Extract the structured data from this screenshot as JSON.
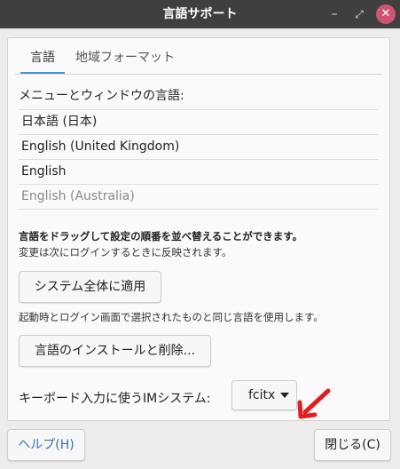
{
  "window": {
    "title": "言語サポート",
    "controls": {
      "minimize": "–",
      "maximize": "⤢",
      "close": "✕"
    }
  },
  "tabs": [
    {
      "label": "言語",
      "active": true
    },
    {
      "label": "地域フォーマット",
      "active": false
    }
  ],
  "language_section": {
    "heading": "メニューとウィンドウの言語:",
    "languages": [
      {
        "label": "日本語 (日本)",
        "enabled": true
      },
      {
        "label": "English (United Kingdom)",
        "enabled": true
      },
      {
        "label": "English",
        "enabled": true
      },
      {
        "label": "English (Australia)",
        "enabled": false
      }
    ],
    "drag_hint": "言語をドラッグして設定の順番を並べ替えることができます。",
    "relogin_hint": "変更は次にログインするときに反映されます。"
  },
  "apply_button": {
    "label": "システム全体に適用"
  },
  "system_hint": "起動時とログイン画面で選択されたものと同じ言語を使用します。",
  "install_button": {
    "label": "言語のインストールと削除..."
  },
  "keyboard_input": {
    "label": "キーボード入力に使うIMシステム:",
    "selected": "fcitx"
  },
  "footer": {
    "help_button": "ヘルプ(H)",
    "close_button": "閉じる(C)"
  },
  "colors": {
    "titlebar": "#3f3f3f",
    "close_button": "#cf5474",
    "annotation_arrow": "#e02020",
    "tab_underline": "#4a90d9"
  }
}
